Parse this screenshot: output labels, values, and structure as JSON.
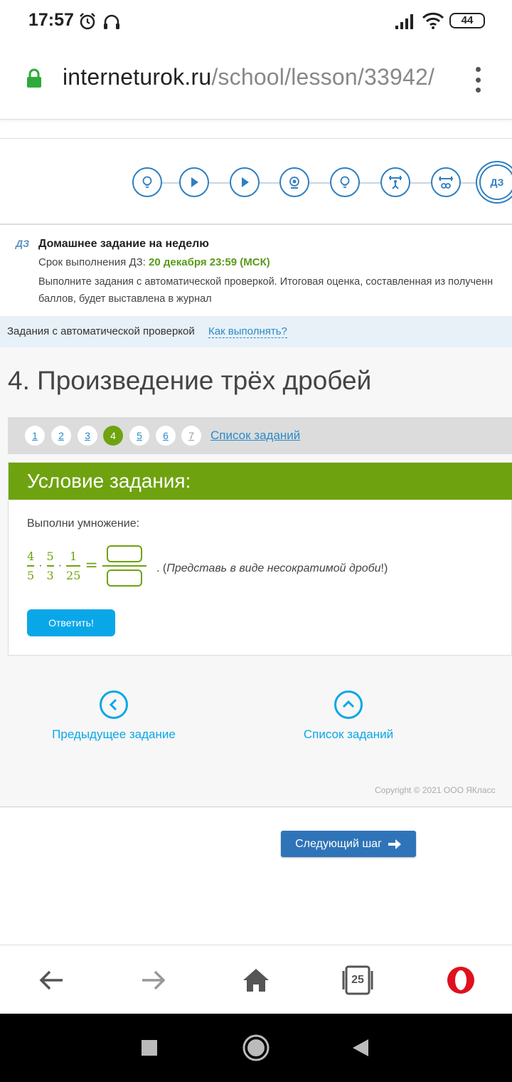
{
  "status": {
    "time": "17:57",
    "battery": "44"
  },
  "url": {
    "domain": "interneturok.ru",
    "path": "/school/lesson/33942/"
  },
  "steps": {
    "items": [
      "lightbulb-icon",
      "play-icon",
      "play-icon",
      "webcam-icon",
      "lightbulb-icon",
      "weightlifter-icon",
      "barbell-icon",
      "homework"
    ],
    "active_label": "ДЗ"
  },
  "homework": {
    "badge": "ДЗ",
    "title": "Домашнее задание на неделю",
    "deadline_label": "Срок выполнения ДЗ: ",
    "deadline_value": "20 декабря 23:59 (МСК)",
    "desc_line1": "Выполните задания с автоматической проверкой. Итоговая оценка, составленная из полученн",
    "desc_line2": "баллов, будет выставлена в журнал"
  },
  "auto_check": {
    "label": "Задания с автоматической проверкой",
    "link": "Как выполнять?"
  },
  "task": {
    "title": "4. Произведение трёх дробей",
    "pages": [
      "1",
      "2",
      "3",
      "4",
      "5",
      "6",
      "7"
    ],
    "active_page": "4",
    "list_link": "Список заданий",
    "condition_title": "Условие задания:",
    "instruction": "Выполни умножение:",
    "fractions": [
      {
        "num": "4",
        "den": "5"
      },
      {
        "num": "5",
        "den": "3"
      },
      {
        "num": "1",
        "den": "25"
      }
    ],
    "dot": "·",
    "equals": "=",
    "hint_prefix": ". (",
    "hint_text": "Представь в виде несократимой дроби",
    "hint_suffix": "!)",
    "answer_button": "Ответить!"
  },
  "navigation": {
    "prev": "Предыдущее задание",
    "list": "Список заданий"
  },
  "copyright": "Copyright © 2021 ООО ЯКласс",
  "next_step": "Следующий шаг",
  "browser": {
    "tabs_count": "25"
  }
}
